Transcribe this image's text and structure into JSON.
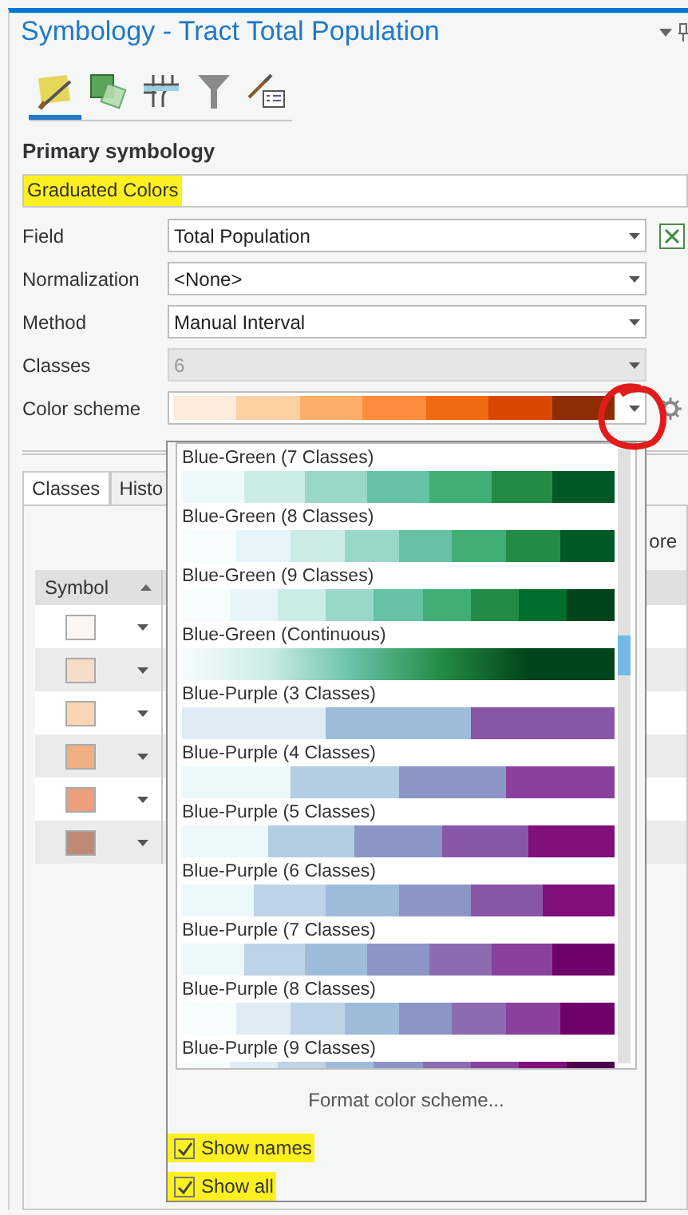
{
  "panel": {
    "title": "Symbology - Tract Total Population"
  },
  "toolbar_tabs": [
    {
      "kind": "brush",
      "selected": true
    },
    {
      "kind": "squares",
      "selected": false
    },
    {
      "kind": "grid",
      "selected": false
    },
    {
      "kind": "filter",
      "selected": false
    },
    {
      "kind": "list",
      "selected": false
    }
  ],
  "section_title": "Primary symbology",
  "renderer": {
    "value": "Graduated Colors",
    "highlighted": true
  },
  "fields": [
    {
      "kind": "select",
      "label": "Field",
      "value": "Total Population",
      "disabled": false,
      "expression_button": true
    },
    {
      "kind": "select",
      "label": "Normalization",
      "value": "<None>",
      "disabled": false,
      "expression_button": false
    },
    {
      "kind": "select",
      "label": "Method",
      "value": "Manual Interval",
      "disabled": false,
      "expression_button": false
    },
    {
      "kind": "select",
      "label": "Classes",
      "value": "6",
      "disabled": true,
      "expression_button": false
    },
    {
      "kind": "color_scheme",
      "label": "Color scheme",
      "stops": [
        {
          "color": "#fdebdc"
        },
        {
          "color": "#fdd0a2"
        },
        {
          "color": "#fdae6b"
        },
        {
          "color": "#fd8d3c"
        },
        {
          "color": "#f16913"
        },
        {
          "color": "#d94801"
        },
        {
          "color": "#8c2d04"
        }
      ]
    }
  ],
  "classes_tabs": [
    {
      "label": "Classes",
      "selected": true
    },
    {
      "label": "Histo",
      "selected": false
    }
  ],
  "more_text": "ore",
  "table": {
    "columns": [
      "Symbol"
    ],
    "rows": [
      {
        "color": "#fdf5f0"
      },
      {
        "color": "#f5dcc7"
      },
      {
        "color": "#fdd5b5"
      },
      {
        "color": "#efae84"
      },
      {
        "color": "#ed9e7c"
      },
      {
        "color": "#bd8a78"
      }
    ]
  },
  "color_scheme_dropdown": {
    "schemes": [
      {
        "kind": "classes",
        "name": "Blue-Green (7 Classes)",
        "stops": [
          {
            "color": "#edf8fb"
          },
          {
            "color": "#ccece6"
          },
          {
            "color": "#99d8c9"
          },
          {
            "color": "#66c2a4"
          },
          {
            "color": "#41ae76"
          },
          {
            "color": "#238b45"
          },
          {
            "color": "#005824"
          }
        ]
      },
      {
        "kind": "classes",
        "name": "Blue-Green (8 Classes)",
        "stops": [
          {
            "color": "#f7fcfd"
          },
          {
            "color": "#e5f5f9"
          },
          {
            "color": "#ccece6"
          },
          {
            "color": "#99d8c9"
          },
          {
            "color": "#66c2a4"
          },
          {
            "color": "#41ae76"
          },
          {
            "color": "#238b45"
          },
          {
            "color": "#005824"
          }
        ]
      },
      {
        "kind": "classes",
        "name": "Blue-Green (9 Classes)",
        "stops": [
          {
            "color": "#f7fcfd"
          },
          {
            "color": "#e5f5f9"
          },
          {
            "color": "#ccece6"
          },
          {
            "color": "#99d8c9"
          },
          {
            "color": "#66c2a4"
          },
          {
            "color": "#41ae76"
          },
          {
            "color": "#238b45"
          },
          {
            "color": "#006d2c"
          },
          {
            "color": "#00441b"
          }
        ]
      },
      {
        "kind": "continuous",
        "name": "Blue-Green (Continuous)",
        "stops": [
          {
            "color": "#f7fcfd"
          },
          {
            "color": "#ccece6"
          },
          {
            "color": "#66c2a4"
          },
          {
            "color": "#238b45"
          },
          {
            "color": "#00441b"
          }
        ]
      },
      {
        "kind": "classes",
        "name": "Blue-Purple (3 Classes)",
        "stops": [
          {
            "color": "#e0ecf4"
          },
          {
            "color": "#9ebcda"
          },
          {
            "color": "#8856a7"
          }
        ]
      },
      {
        "kind": "classes",
        "name": "Blue-Purple (4 Classes)",
        "stops": [
          {
            "color": "#edf8fb"
          },
          {
            "color": "#b3cde3"
          },
          {
            "color": "#8c96c6"
          },
          {
            "color": "#88419d"
          }
        ]
      },
      {
        "kind": "classes",
        "name": "Blue-Purple (5 Classes)",
        "stops": [
          {
            "color": "#edf8fb"
          },
          {
            "color": "#b3cde3"
          },
          {
            "color": "#8c96c6"
          },
          {
            "color": "#8856a7"
          },
          {
            "color": "#810f7c"
          }
        ]
      },
      {
        "kind": "classes",
        "name": "Blue-Purple (6 Classes)",
        "stops": [
          {
            "color": "#edf8fb"
          },
          {
            "color": "#bfd3e6"
          },
          {
            "color": "#9ebcda"
          },
          {
            "color": "#8c96c6"
          },
          {
            "color": "#8856a7"
          },
          {
            "color": "#810f7c"
          }
        ]
      },
      {
        "kind": "classes",
        "name": "Blue-Purple (7 Classes)",
        "stops": [
          {
            "color": "#edf8fb"
          },
          {
            "color": "#bfd3e6"
          },
          {
            "color": "#9ebcda"
          },
          {
            "color": "#8c96c6"
          },
          {
            "color": "#8c6bb1"
          },
          {
            "color": "#88419d"
          },
          {
            "color": "#6e016b"
          }
        ]
      },
      {
        "kind": "classes",
        "name": "Blue-Purple (8 Classes)",
        "stops": [
          {
            "color": "#f7fcfd"
          },
          {
            "color": "#e0ecf4"
          },
          {
            "color": "#bfd3e6"
          },
          {
            "color": "#9ebcda"
          },
          {
            "color": "#8c96c6"
          },
          {
            "color": "#8c6bb1"
          },
          {
            "color": "#88419d"
          },
          {
            "color": "#6e016b"
          }
        ]
      },
      {
        "kind": "classes",
        "name": "Blue-Purple (9 Classes)",
        "stops": [
          {
            "color": "#f7fcfd"
          },
          {
            "color": "#e0ecf4"
          },
          {
            "color": "#bfd3e6"
          },
          {
            "color": "#9ebcda"
          },
          {
            "color": "#8c96c6"
          },
          {
            "color": "#8c6bb1"
          },
          {
            "color": "#88419d"
          },
          {
            "color": "#810f7c"
          },
          {
            "color": "#4d004b"
          }
        ]
      }
    ],
    "format_link": "Format color scheme...",
    "options": [
      {
        "label": "Show names",
        "checked": true,
        "highlighted": true
      },
      {
        "label": "Show all",
        "checked": true,
        "highlighted": true
      }
    ]
  }
}
